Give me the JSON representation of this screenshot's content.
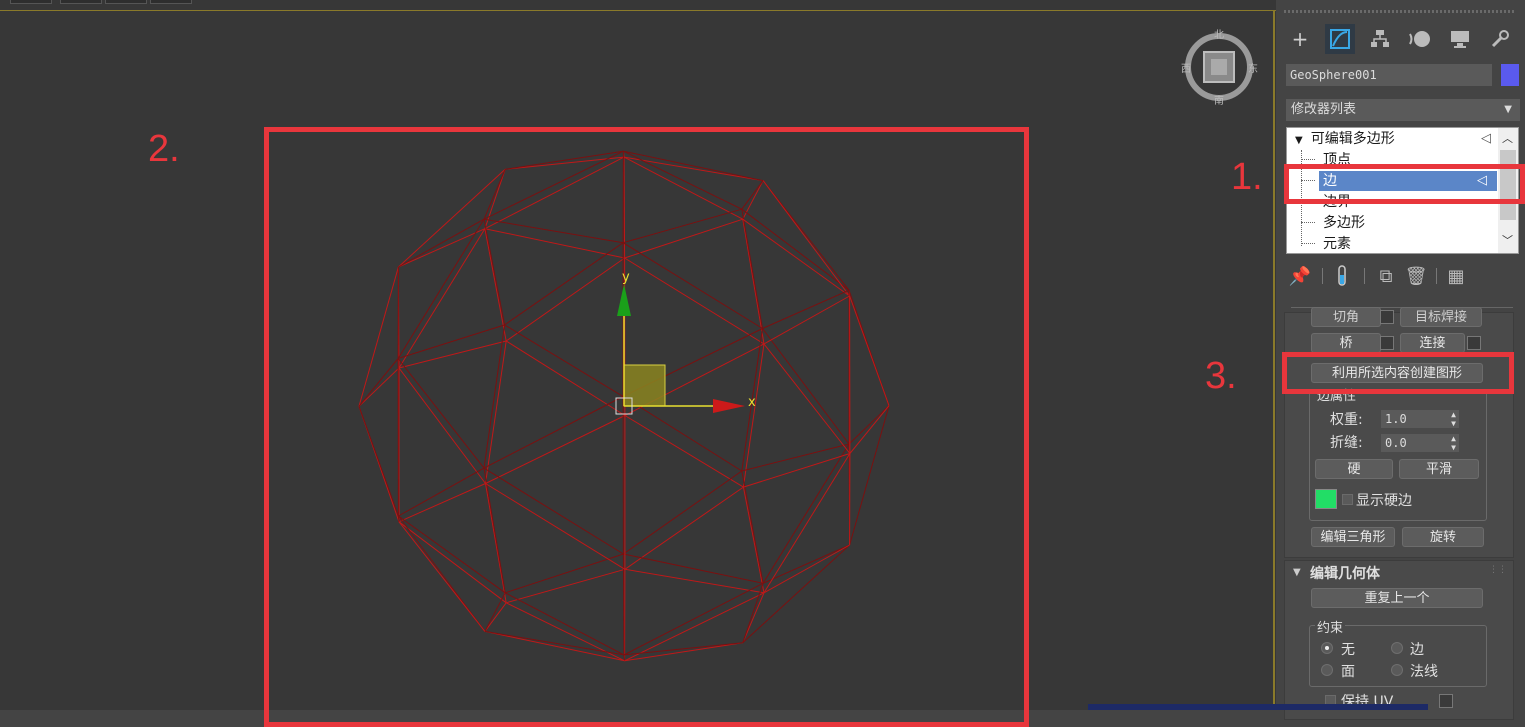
{
  "viewport": {
    "annotations": {
      "one": "1.",
      "two": "2.",
      "three": "3."
    },
    "gizmo": {
      "y_label": "y",
      "x_label": "x"
    },
    "viewcube": {
      "north": "北",
      "south": "南",
      "east": "东",
      "west": "西"
    },
    "colors": {
      "wire": "#c01818",
      "highlight": "#e8363c",
      "gizmo_y": "#1aa01a",
      "gizmo_x": "#cc1a1a",
      "gizmo_plane": "#b8b020"
    }
  },
  "panel": {
    "tabs": [
      "create-icon",
      "modify-icon",
      "hierarchy-icon",
      "motion-icon",
      "display-icon",
      "utilities-icon"
    ],
    "object_name": "GeoSphere001",
    "object_color": "#5a5aee",
    "modifier_list": "修改器列表",
    "stack": {
      "root": "可编辑多边形",
      "items": [
        "顶点",
        "边",
        "边界",
        "多边形",
        "元素"
      ],
      "selected": "边"
    },
    "edit_edges": {
      "partial_top_left": "切角",
      "partial_top_right": "目标焊接",
      "bridge": "桥",
      "connect": "连接",
      "create_shape": "利用所选内容创建图形",
      "edge_props_title": "边属性",
      "weight_label": "权重:",
      "weight_value": "1.0",
      "crease_label": "折缝:",
      "crease_value": "0.0",
      "hard": "硬",
      "smooth": "平滑",
      "show_hard_edges": "显示硬边",
      "hard_edge_color": "#22dd66",
      "edit_tri": "编辑三角形",
      "turn": "旋转"
    },
    "edit_geometry": {
      "title": "编辑几何体",
      "repeat_last": "重复上一个",
      "constraints_title": "约束",
      "none": "无",
      "edge": "边",
      "face": "面",
      "normal": "法线",
      "preserve_uv": "保持 UV"
    }
  }
}
